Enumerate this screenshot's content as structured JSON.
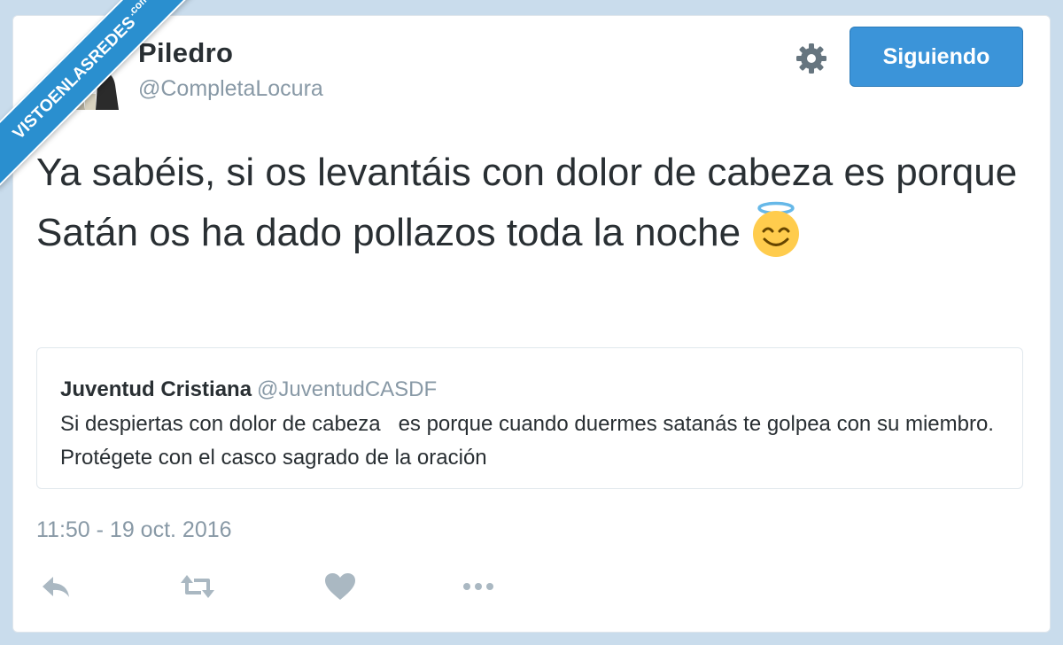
{
  "watermark": {
    "text": "VISTOENLASREDES",
    "suffix": ".com",
    "color": "#2a8fcf"
  },
  "author": {
    "name": "Piledro",
    "handle": "@CompletaLocura"
  },
  "header": {
    "settings_icon": "gear-icon",
    "follow_label": "Siguiendo",
    "accent_color": "#3b94d9"
  },
  "tweet": {
    "text": "Ya sabéis, si os levantáis con dolor de cabeza es porque Satán os ha dado pollazos toda la noche",
    "emoji": "smiling-face-with-halo"
  },
  "quote": {
    "name": "Juventud Cristiana",
    "handle": "@JuventudCASDF",
    "text": "Si despiertas con dolor de cabeza   es porque cuando duermes satanás te golpea con su miembro. Protégete con el casco sagrado de la oración"
  },
  "timestamp": "11:50 - 19 oct. 2016",
  "actions": [
    "reply-icon",
    "retweet-icon",
    "like-icon",
    "more-icon"
  ]
}
